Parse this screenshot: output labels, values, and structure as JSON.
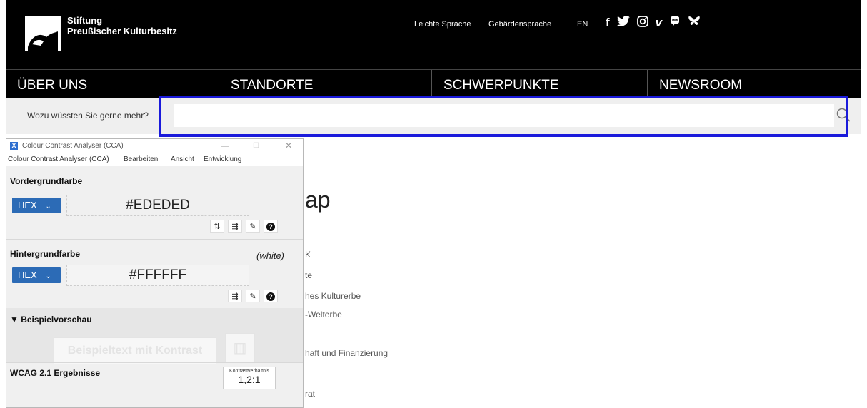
{
  "header": {
    "org_line1": "Stiftung",
    "org_line2": "Preußischer Kulturbesitz",
    "util_links": [
      "Leichte Sprache",
      "Gebärdensprache",
      "EN"
    ],
    "social_icons": [
      "facebook-icon",
      "twitter-icon",
      "instagram-icon",
      "vimeo-icon",
      "mastodon-icon",
      "bluesky-icon"
    ],
    "social_glyphs": [
      "f",
      "𝕥",
      "◎",
      "v",
      "ⓜ",
      "ʬ"
    ]
  },
  "nav": {
    "items": [
      "ÜBER UNS",
      "STANDORTE",
      "SCHWERPUNKTE",
      "NEWSROOM"
    ]
  },
  "search": {
    "label": "Wozu wüssten Sie gerne mehr?",
    "value": "",
    "placeholder": "",
    "highlight_color": "#1a1adb"
  },
  "page": {
    "title_fragment": "ap",
    "list_fragments": [
      "K",
      "te",
      "hes Kulturerbe",
      "-Welterbe",
      "haft und Finanzierung",
      "rat"
    ]
  },
  "cca": {
    "window_title": "Colour Contrast Analyser (CCA)",
    "app_icon": "X",
    "window_controls": [
      "—",
      "☐",
      "✕"
    ],
    "menu": [
      "Colour Contrast Analyser (CCA)",
      "Bearbeiten",
      "Ansicht",
      "Entwicklung"
    ],
    "foreground": {
      "label": "Vordergrundfarbe",
      "format": "HEX",
      "value": "#EDEDED",
      "tools": [
        "⇅",
        "⇶",
        "✎",
        "?"
      ]
    },
    "background": {
      "label": "Hintergrundfarbe",
      "named": "(white)",
      "format": "HEX",
      "value": "#FFFFFF",
      "tools": [
        "⇶",
        "✎",
        "?"
      ]
    },
    "preview": {
      "label": "▼ Beispielvorschau",
      "sample_text": "Beispieltext mit Kontrast",
      "sample_image_glyph": "▥"
    },
    "results": {
      "label": "WCAG 2.1 Ergebnisse",
      "ratio_label": "Kontrastverhältnis",
      "ratio_value": "1,2:1"
    }
  },
  "colors": {
    "header_bg": "#000000",
    "search_row_bg": "#efefef",
    "hex_select_bg": "#2c6bb6"
  }
}
